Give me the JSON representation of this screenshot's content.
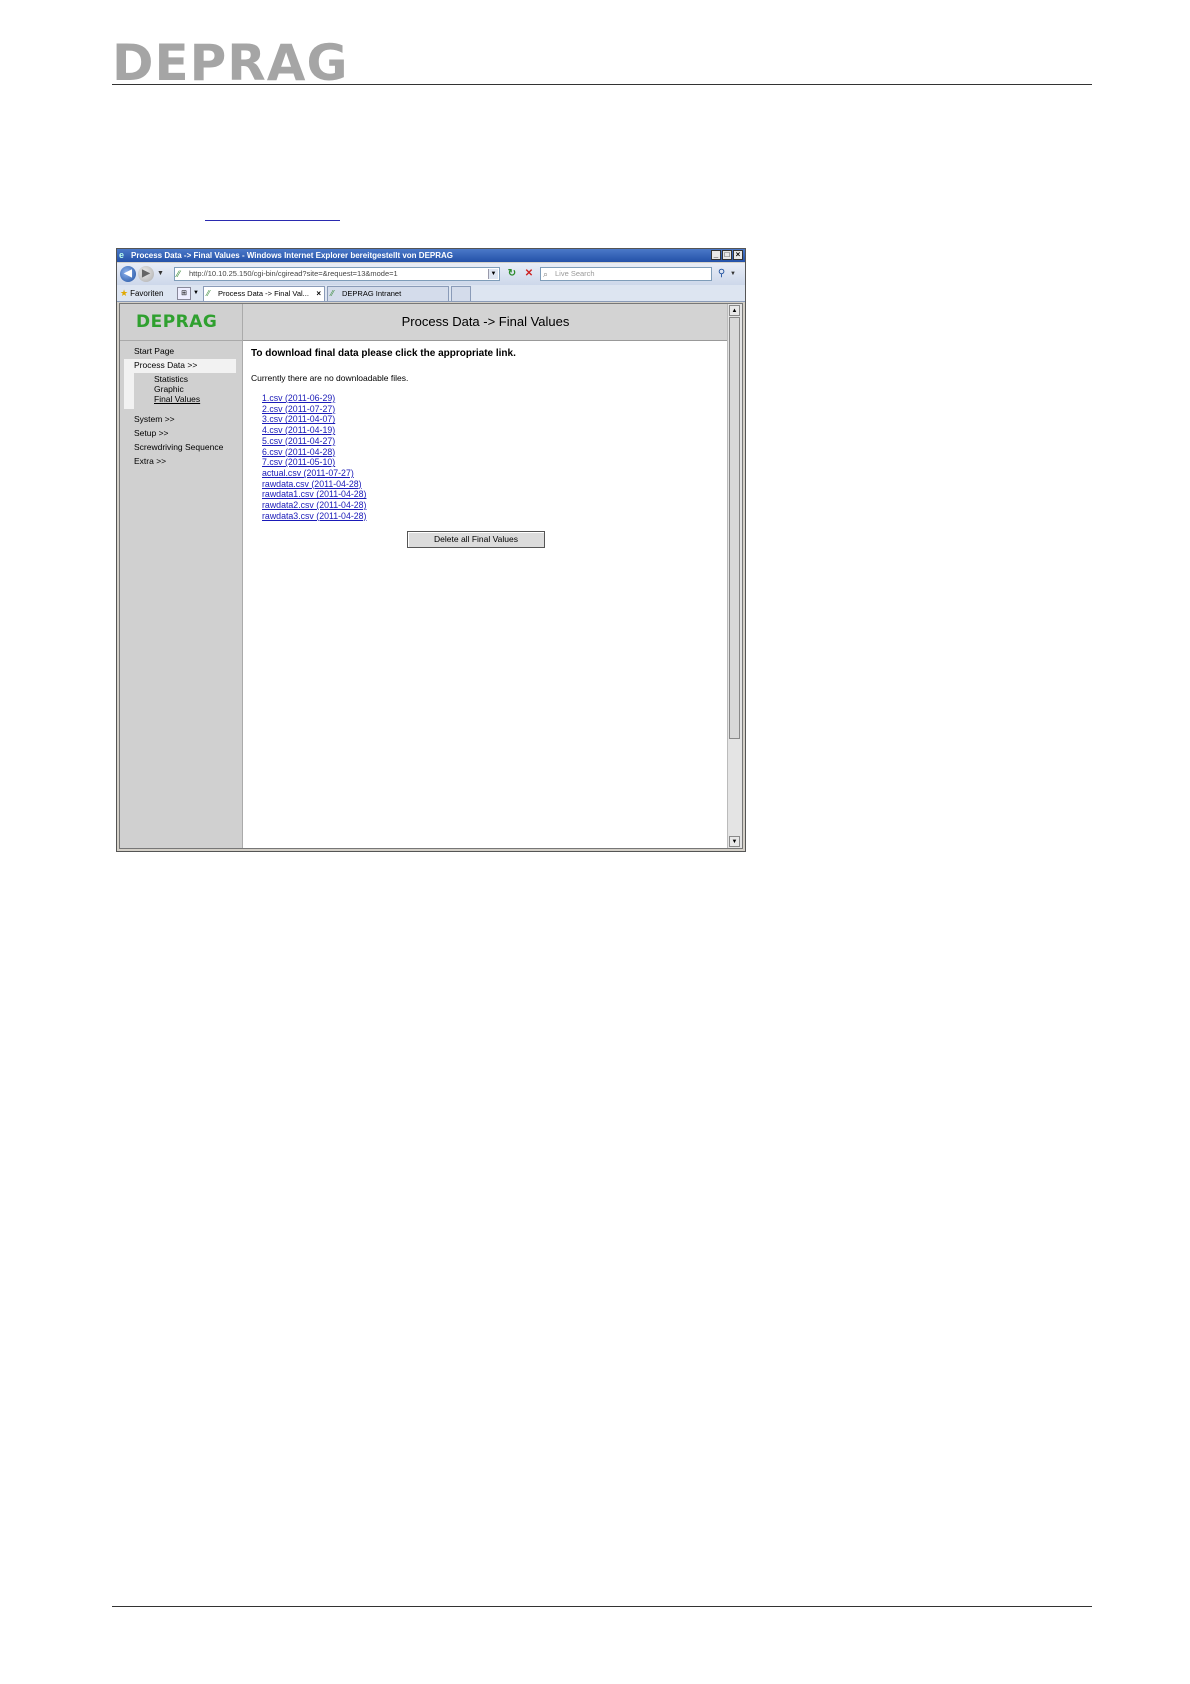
{
  "document": {
    "logo_text": "DEPRAG"
  },
  "window": {
    "title": "Process Data -> Final Values - Windows Internet Explorer bereitgestellt von DEPRAG",
    "address": "http://10.10.25.150/cgi-bin/cgiread?site=&request=13&mode=1",
    "search_placeholder": "Live Search",
    "favorites_label": "Favoriten",
    "tabs": [
      {
        "label": "Process Data -> Final Val...",
        "active": true
      },
      {
        "label": "DEPRAG Intranet",
        "active": false
      }
    ]
  },
  "app": {
    "logo_text": "DEPRAG",
    "page_title": "Process Data -> Final Values",
    "instruction": "To download final data please click the appropriate link.",
    "note": "Currently there are no downloadable files.",
    "menu": [
      {
        "label": "Start Page"
      },
      {
        "label": "Process Data >>"
      },
      {
        "label": "System >>"
      },
      {
        "label": "Setup >>"
      },
      {
        "label": "Screwdriving Sequence"
      },
      {
        "label": "Extra >>"
      }
    ],
    "submenu": [
      {
        "label": "Statistics"
      },
      {
        "label": "Graphic"
      },
      {
        "label": "Final Values"
      }
    ],
    "files": [
      "1.csv (2011-06-29)",
      "2.csv (2011-07-27)",
      "3.csv (2011-04-07)",
      "4.csv (2011-04-19)",
      "5.csv (2011-04-27)",
      "6.csv (2011-04-28)",
      "7.csv (2011-05-10)",
      "actual.csv (2011-07-27)",
      "rawdata.csv (2011-04-28)",
      "rawdata1.csv (2011-04-28)",
      "rawdata2.csv (2011-04-28)",
      "rawdata3.csv (2011-04-28)"
    ],
    "delete_button": "Delete all Final Values"
  }
}
